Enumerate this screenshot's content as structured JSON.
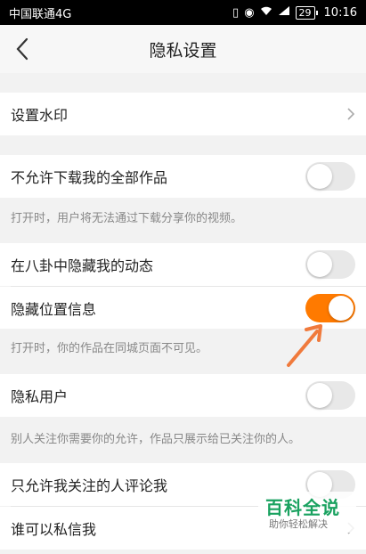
{
  "status_bar": {
    "carrier": "中国联通4G",
    "battery": "29",
    "time": "10:16"
  },
  "header": {
    "title": "隐私设置"
  },
  "settings": [
    {
      "label": "设置水印",
      "type": "chevron"
    },
    {
      "label": "不允许下载我的全部作品",
      "type": "toggle",
      "enabled": false,
      "hint": "打开时，用户将无法通过下载分享你的视频。"
    },
    {
      "label": "在八卦中隐藏我的动态",
      "type": "toggle",
      "enabled": false
    },
    {
      "label": "隐藏位置信息",
      "type": "toggle",
      "enabled": true,
      "hint": "打开时，你的作品在同城页面不可见。"
    },
    {
      "label": "隐私用户",
      "type": "toggle",
      "enabled": false,
      "hint": "别人关注你需要你的允许，作品只展示给已关注你的人。"
    },
    {
      "label": "只允许我关注的人评论我",
      "type": "toggle",
      "enabled": false
    },
    {
      "label": "谁可以私信我",
      "type": "chevron"
    }
  ],
  "watermark": {
    "title": "百科全说",
    "subtitle": "助你轻松解决"
  },
  "colors": {
    "accent": "#ff7a00",
    "toggle_off": "#e8e8e8",
    "arrow": "#f07a3c"
  }
}
